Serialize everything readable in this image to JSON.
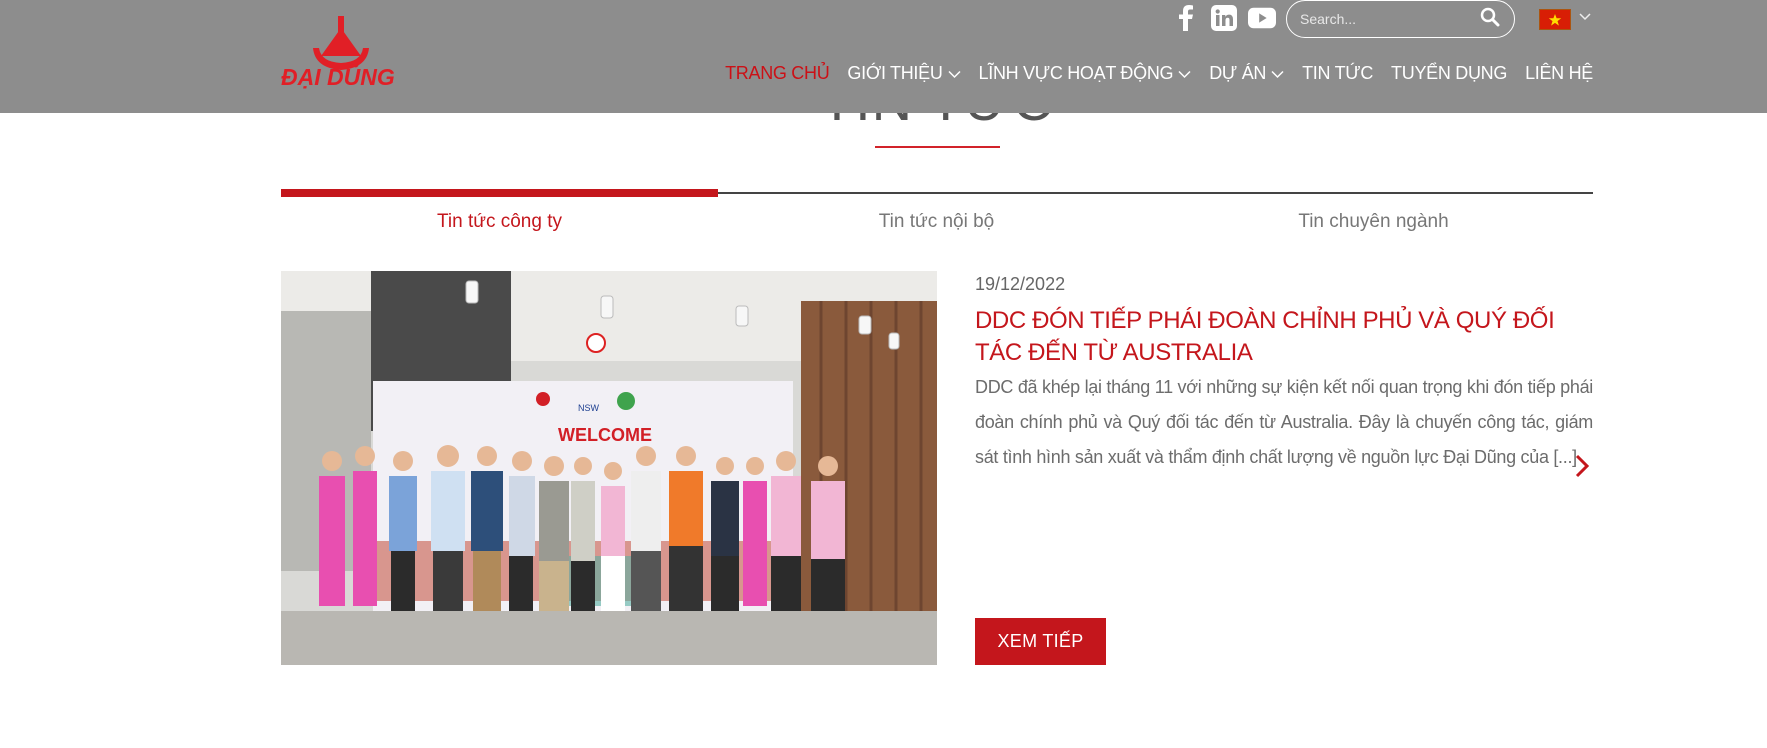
{
  "brand": {
    "logo_text": "ĐẠI DŨNG",
    "color": "#e11f26"
  },
  "header": {
    "background": "#8d8d8d",
    "socials": [
      {
        "icon": "facebook-icon"
      },
      {
        "icon": "linkedin-icon"
      },
      {
        "icon": "youtube-icon"
      }
    ],
    "search": {
      "placeholder": "Search...",
      "value": ""
    },
    "language": {
      "icon": "vietnam-flag-icon"
    }
  },
  "nav": {
    "items": [
      {
        "label": "TRANG CHỦ",
        "active": true,
        "dropdown": false
      },
      {
        "label": "GIỚI THIỆU",
        "active": false,
        "dropdown": true
      },
      {
        "label": "LĨNH VỰC HOẠT ĐỘNG",
        "active": false,
        "dropdown": true
      },
      {
        "label": "DỰ ÁN",
        "active": false,
        "dropdown": true
      },
      {
        "label": "TIN TỨC",
        "active": false,
        "dropdown": false
      },
      {
        "label": "TUYỂN DỤNG",
        "active": false,
        "dropdown": false
      },
      {
        "label": "LIÊN HỆ",
        "active": false,
        "dropdown": false
      }
    ]
  },
  "section": {
    "title": "TIN TỨC",
    "tabs": [
      {
        "label": "Tin tức công ty",
        "active": true
      },
      {
        "label": "Tin tức nội bộ",
        "active": false
      },
      {
        "label": "Tin chuyên ngành",
        "active": false
      }
    ]
  },
  "post": {
    "date": "19/12/2022",
    "title": "DDC ĐÓN TIẾP PHÁI ĐOÀN CHỈNH PHỦ VÀ QUÝ ĐỐI TÁC ĐẾN TỪ AUSTRALIA",
    "excerpt": "DDC đã khép lại tháng 11 với những sự kiện kết nối quan trọng khi đón tiếp phái đoàn chính phủ và Quý đối tác đến từ Australia. Đây là chuyến công tác, giám sát tình hình sản xuất và thẩm định chất lượng về nguồn lực Đại Dũng của [...]",
    "read_more": "XEM TIẾP",
    "banner_text": "WELCOME",
    "banner_logo": "NSW"
  },
  "colors": {
    "accent": "#c4161c",
    "header": "#8d8d8d"
  }
}
